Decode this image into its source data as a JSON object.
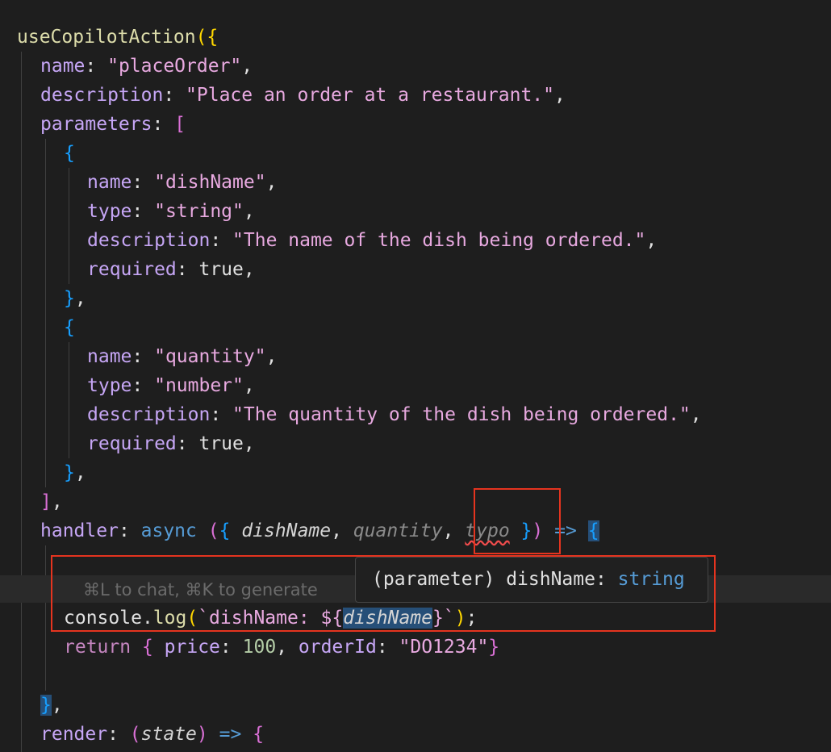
{
  "code": {
    "l1_fn": "useCopilotAction",
    "l1_open": "({",
    "name_key": "name",
    "name_val": "\"placeOrder\"",
    "desc_key": "description",
    "desc_val": "\"Place an order at a restaurant.\"",
    "params_key": "parameters",
    "p1_name_val": "\"dishName\"",
    "p1_type_val": "\"string\"",
    "p1_desc_val": "\"The name of the dish being ordered.\"",
    "p2_name_val": "\"quantity\"",
    "p2_type_val": "\"number\"",
    "p2_desc_val": "\"The quantity of the dish being ordered.\"",
    "type_key": "type",
    "required_key": "required",
    "true_val": "true",
    "handler_key": "handler",
    "async_kw": "async",
    "arg_dishName": "dishName",
    "arg_quantity": "quantity",
    "arg_typo": "typo",
    "console_obj": "console",
    "log_fn": "log",
    "tpl_text": "`dishName: ${",
    "tpl_var": "dishName",
    "tpl_close": "}`",
    "return_kw": "return",
    "price_key": "price",
    "price_val": "100",
    "orderId_key": "orderId",
    "orderId_val": "\"DO1234\"",
    "render_key": "render",
    "state_param": "state"
  },
  "ghost_hint": "⌘L to chat, ⌘K to generate",
  "hover": {
    "kind": "(parameter)",
    "name": "dishName",
    "type": "string"
  },
  "colors": {
    "background": "#1e1e1e",
    "annotation_red": "#e5341f",
    "property": "#c6a6f5",
    "string": "#e8a9e0",
    "keyword": "#569cd6"
  }
}
